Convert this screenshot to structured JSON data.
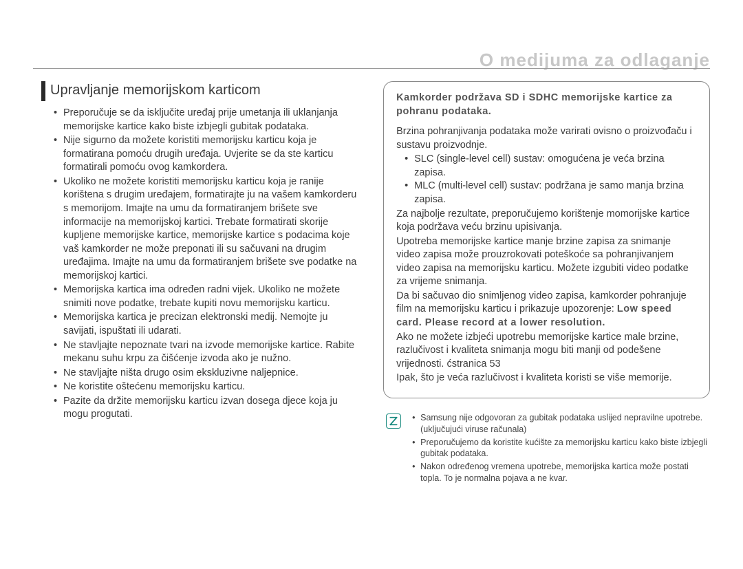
{
  "heading": "O medijuma za odlaganje",
  "page_number": "  ",
  "section": {
    "title": "Upravljanje memorijskom karticom",
    "items": [
      "Preporučuje se da isključite uređaj prije umetanja ili uklanjanja memorijske kartice kako biste izbjegli gubitak podataka.",
      "Nije sigurno da možete koristiti memorijsku karticu koja je formatirana pomoću drugih uređaja. Uvjerite se da ste karticu formatirali pomoću ovog kamkordera.",
      "Ukoliko ne možete koristiti memorijsku karticu koja je ranije korištena s drugim uređajem, formatirajte ju na vašem kamkorderu s memorijom. Imajte na umu da formatiranjem brišete sve informacije na memorijskoj kartici. Trebate formatirati skorije kupljene memorijske kartice, memorijske kartice s podacima koje vaš kamkorder ne može preponati ili su sačuvani na drugim uređajima. Imajte na umu da formatiranjem brišete sve podatke na memorijskoj kartici.",
      "Memorijska kartica ima određen radni vijek. Ukoliko ne možete snimiti nove podatke, trebate kupiti novu memorijsku karticu.",
      "Memorijska kartica je precizan elektronski medij. Nemojte ju savijati, ispuštati ili udarati.",
      "Ne stavljajte nepoznate tvari na izvode memorijske kartice. Rabite mekanu suhu krpu za čišćenje izvoda ako je nužno.",
      "Ne stavljajte ništa drugo osim ekskluzivne naljepnice.",
      "Ne koristite oštećenu memorijsku karticu.",
      "Pazite da držite memorijsku karticu izvan dosega djece koja ju mogu progutati."
    ]
  },
  "box": {
    "title": "Kamkorder podržava SD i SDHC memorijske kartice za pohranu podataka.",
    "para1": "Brzina pohranjivanja podataka može varirati ovisno o proizvođaču i sustavu proizvodnje.",
    "sublist": [
      "SLC (single-level cell) sustav: omogućena je veća brzina zapisa.",
      "MLC (multi-level cell) sustav: podržana je samo manja brzina zapisa."
    ],
    "para2": "Za najbolje rezultate, preporučujemo korištenje momorijske kartice koja podržava veću brzinu upisivanja.",
    "para3": "Upotreba memorijske kartice manje brzine zapisa za snimanje video zapisa može prouzrokovati poteškoće sa pohranjivanjem video zapisa na memorijsku karticu. Možete izgubiti video podatke za vrijeme snimanja.",
    "para4a": "Da bi sačuvao dio snimljenog video zapisa, kamkorder pohranjuje film na memorijsku karticu i prikazuje upozorenje:",
    "warning_bold": "Low speed card. Please record at a lower resolution.",
    "para5": "Ako ne možete izbjeći upotrebu memorijske kartice male brzine, razlučivost i kvaliteta snimanja mogu biti manji od podešene vrijednosti. ćstranica 53",
    "para6": "Ipak, što je veća razlučivost i kvaliteta koristi se više memorije."
  },
  "notes": [
    "Samsung nije odgovoran za gubitak podataka uslijed nepravilne upotrebe. (uključujući viruse računala)",
    "Preporučujemo da koristite kućište za memorijsku karticu kako biste izbjegli gubitak podataka.",
    "Nakon određenog vremena upotrebe, memorijska kartica može postati topla. To je normalna pojava a ne kvar."
  ]
}
